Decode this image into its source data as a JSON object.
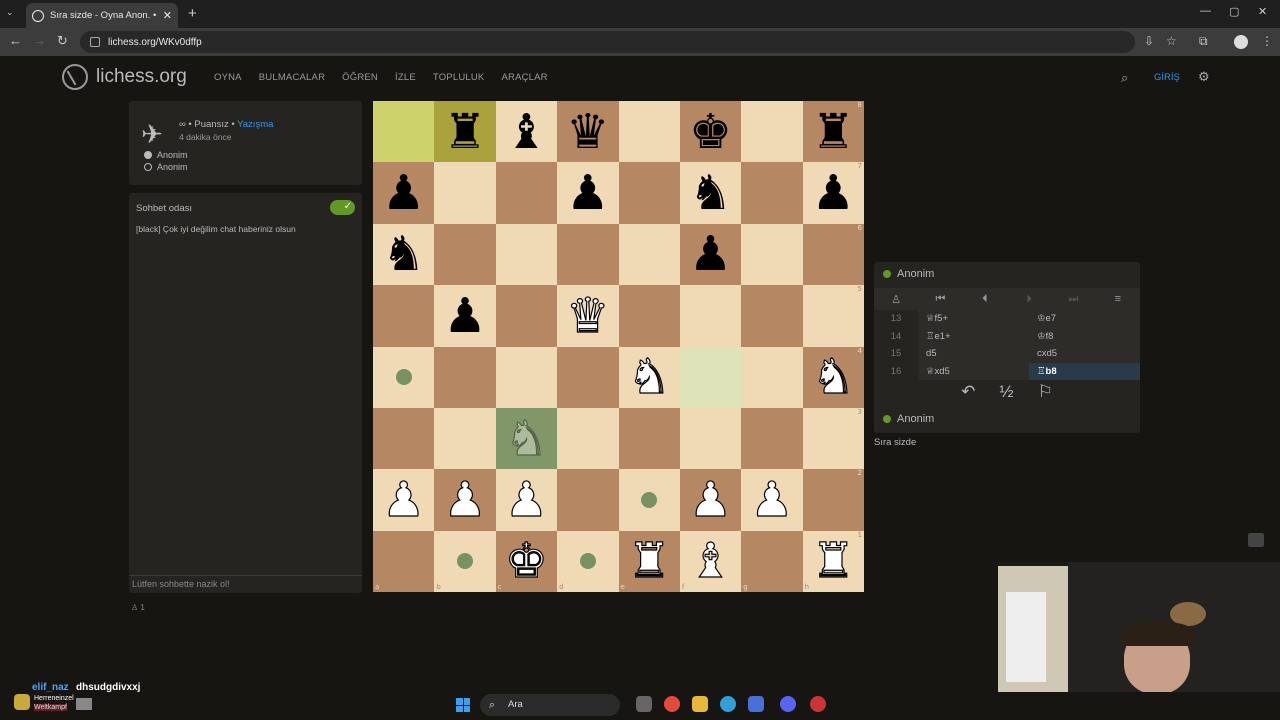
{
  "browser": {
    "tab_title": "Sıra sizde - Oyna Anon. • liches",
    "url": "lichess.org/WKv0dffp"
  },
  "header": {
    "logo_text": "lichess.org",
    "nav": [
      "OYNA",
      "BULMACALAR",
      "ÖĞREN",
      "İZLE",
      "TOPLULUK",
      "ARAÇLAR"
    ],
    "login": "GİRİŞ"
  },
  "game_info": {
    "mode_prefix": "∞ • Puansız • ",
    "mode_link": "Yazışma",
    "time_ago": "4 dakika önce",
    "players": [
      {
        "name": "Anonim",
        "color": "white"
      },
      {
        "name": "Anonim",
        "color": "black"
      }
    ]
  },
  "chat": {
    "title": "Sohbet odası",
    "message": "[black] Çok iyi değilim chat haberiniz olsun",
    "placeholder": "Lütfen sohbette nazik ol!",
    "spectators": "1"
  },
  "board": {
    "ranks": [
      [
        {
          "p": "",
          "c": "hl-light"
        },
        {
          "p": "♜",
          "s": "b",
          "c": "hl-dark"
        },
        {
          "p": "♝",
          "s": "b"
        },
        {
          "p": "♛",
          "s": "b"
        },
        {
          "p": ""
        },
        {
          "p": "♚",
          "s": "b"
        },
        {
          "p": ""
        },
        {
          "p": "♜",
          "s": "b"
        }
      ],
      [
        {
          "p": "♟",
          "s": "b"
        },
        {
          "p": ""
        },
        {
          "p": ""
        },
        {
          "p": "♟",
          "s": "b"
        },
        {
          "p": ""
        },
        {
          "p": "♞",
          "s": "b"
        },
        {
          "p": ""
        },
        {
          "p": "♟",
          "s": "b"
        }
      ],
      [
        {
          "p": "♞",
          "s": "b"
        },
        {
          "p": ""
        },
        {
          "p": ""
        },
        {
          "p": ""
        },
        {
          "p": ""
        },
        {
          "p": "♟",
          "s": "b"
        },
        {
          "p": ""
        },
        {
          "p": ""
        }
      ],
      [
        {
          "p": ""
        },
        {
          "p": "♟",
          "s": "b",
          "ring": true
        },
        {
          "p": ""
        },
        {
          "p": "♛",
          "s": "w"
        },
        {
          "p": ""
        },
        {
          "p": ""
        },
        {
          "p": ""
        },
        {
          "p": ""
        }
      ],
      [
        {
          "p": "",
          "dot": true
        },
        {
          "p": ""
        },
        {
          "p": ""
        },
        {
          "p": ""
        },
        {
          "p": "♞",
          "s": "w"
        },
        {
          "p": "",
          "c": "mv-light"
        },
        {
          "p": ""
        },
        {
          "p": "♞",
          "s": "w"
        }
      ],
      [
        {
          "p": ""
        },
        {
          "p": ""
        },
        {
          "p": "♞",
          "s": "w",
          "c": "sel-dark",
          "ghost": true
        },
        {
          "p": ""
        },
        {
          "p": ""
        },
        {
          "p": ""
        },
        {
          "p": ""
        },
        {
          "p": ""
        }
      ],
      [
        {
          "p": "♟",
          "s": "w"
        },
        {
          "p": "♟",
          "s": "w"
        },
        {
          "p": "♟",
          "s": "w"
        },
        {
          "p": ""
        },
        {
          "p": "",
          "dot": true
        },
        {
          "p": "♟",
          "s": "w"
        },
        {
          "p": "♟",
          "s": "w"
        },
        {
          "p": ""
        }
      ],
      [
        {
          "p": ""
        },
        {
          "p": "",
          "dot": true
        },
        {
          "p": "♚",
          "s": "w"
        },
        {
          "p": "",
          "dot": true
        },
        {
          "p": "♜",
          "s": "w"
        },
        {
          "p": "♝",
          "s": "w"
        },
        {
          "p": ""
        },
        {
          "p": "♜",
          "s": "w"
        }
      ]
    ],
    "files": [
      "a",
      "b",
      "c",
      "d",
      "e",
      "f",
      "g",
      "h"
    ],
    "rank_labels": [
      "8",
      "7",
      "6",
      "5",
      "4",
      "3",
      "2",
      "1"
    ]
  },
  "right_panel": {
    "top_player": "Anonim",
    "bottom_player": "Anonim",
    "moves": [
      {
        "num": "13",
        "white": "♕f5+",
        "black": "♔e7"
      },
      {
        "num": "14",
        "white": "♖e1+",
        "black": "♔f8"
      },
      {
        "num": "15",
        "white": "d5",
        "black": "cxd5"
      },
      {
        "num": "16",
        "white": "♕xd5",
        "black": "♖b8"
      }
    ],
    "draw_label": "½",
    "turn_text": "Sıra sizde"
  },
  "overlay": {
    "name": "elif_naz",
    "message": "dhsudgdivxxj",
    "sub1": "Herreneinzel",
    "sub2": "Weltkampf"
  },
  "taskbar": {
    "search": "Ara"
  }
}
